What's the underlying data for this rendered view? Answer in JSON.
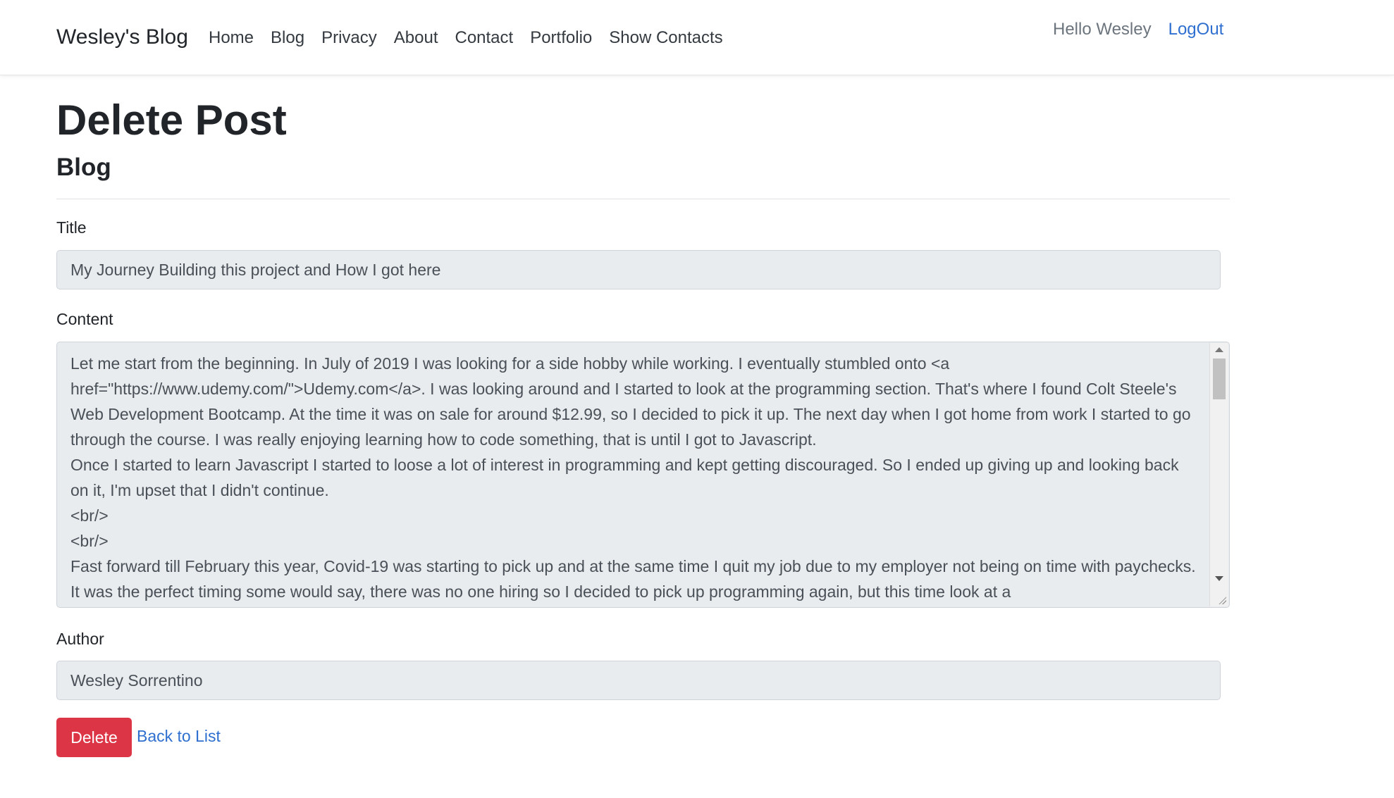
{
  "navbar": {
    "brand": "Wesley's Blog",
    "links": [
      "Home",
      "Blog",
      "Privacy",
      "About",
      "Contact",
      "Portfolio",
      "Show Contacts"
    ],
    "greeting": "Hello Wesley",
    "logout": "LogOut"
  },
  "page": {
    "title": "Delete Post",
    "subtitle": "Blog"
  },
  "form": {
    "title_label": "Title",
    "title_value": "My Journey Building this project and How I got here",
    "content_label": "Content",
    "content_value": "Let me start from the beginning. In July of 2019 I was looking for a side hobby while working. I eventually stumbled onto <a href=\"https://www.udemy.com/\">Udemy.com</a>. I was looking around and I started to look at the programming section. That's where I found Colt Steele's Web Development Bootcamp. At the time it was on sale for around $12.99, so I decided to pick it up. The next day when I got home from work I started to go through the course. I was really enjoying learning how to code something, that is until I got to Javascript.\nOnce I started to learn Javascript I started to loose a lot of interest in programming and kept getting discouraged. So I ended up giving up and looking back on it, I'm upset that I didn't continue.\n<br/>\n<br/>\nFast forward till February this year, Covid-19 was starting to pick up and at the same time I quit my job due to my employer not being on time with paychecks. It was the perfect timing some would say, there was no one hiring so I decided to pick up programming again, but this time look at a",
    "author_label": "Author",
    "author_value": "Wesley Sorrentino"
  },
  "actions": {
    "delete": "Delete",
    "back": "Back to List"
  },
  "colors": {
    "danger": "#dc3545",
    "link": "#2e6fd0",
    "field_bg": "#e9ecef"
  }
}
